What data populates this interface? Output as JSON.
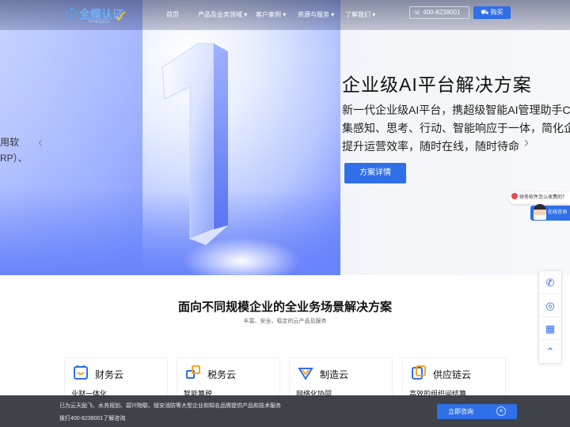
{
  "header": {
    "logo_text": "全蝶认证",
    "logo_sub": "KINGDEE",
    "nav": [
      "首页",
      "产品及业务领域",
      "客户案例",
      "资源与服务",
      "了解我们"
    ],
    "nav_dropdown": [
      false,
      true,
      true,
      true,
      true
    ],
    "phone": "400-8238001",
    "buy_label": "购买"
  },
  "hero": {
    "left_text_1": "用软",
    "left_text_2": "RP）、",
    "title": "企业级AI平台解决方案",
    "desc_1": "新一代企业级AI平台，携超级智能AI管理助手Co",
    "desc_2": "集感知、思考、行动、智能响应于一体，简化企",
    "desc_3": "提升运营效率，随时在线，随时待命",
    "button": "方案详情",
    "prev": "‹",
    "next": "›"
  },
  "side": {
    "consult_pill": "财务软件怎么收费的？",
    "agent_label": "在线咨询"
  },
  "section": {
    "title": "面向不同规模企业的全业务场景解决方案",
    "subtitle": "丰富、安全、稳定的云产品及服务",
    "cards": [
      {
        "name": "财务云",
        "tag": "业财一体化",
        "icon": "finance-cloud-icon"
      },
      {
        "name": "税务云",
        "tag": "智能算税",
        "icon": "tax-cloud-icon"
      },
      {
        "name": "制造云",
        "tag": "网络化协同",
        "icon": "manufacturing-cloud-icon"
      },
      {
        "name": "供应链云",
        "tag": "高效的组织间结算",
        "icon": "supply-chain-cloud-icon"
      }
    ]
  },
  "bottom_bar": {
    "line1": "已为云天励飞、水务规划、碧兴物联、赋安消防等大型企业和知名品牌提供产品和技术服务",
    "line2": "拨打400-8238001了解咨询",
    "cta": "立即咨询",
    "close": "×"
  },
  "colors": {
    "accent": "#2f6fe8",
    "hero_blue": "#6d86ff",
    "bottom_bg": "#32343c"
  }
}
